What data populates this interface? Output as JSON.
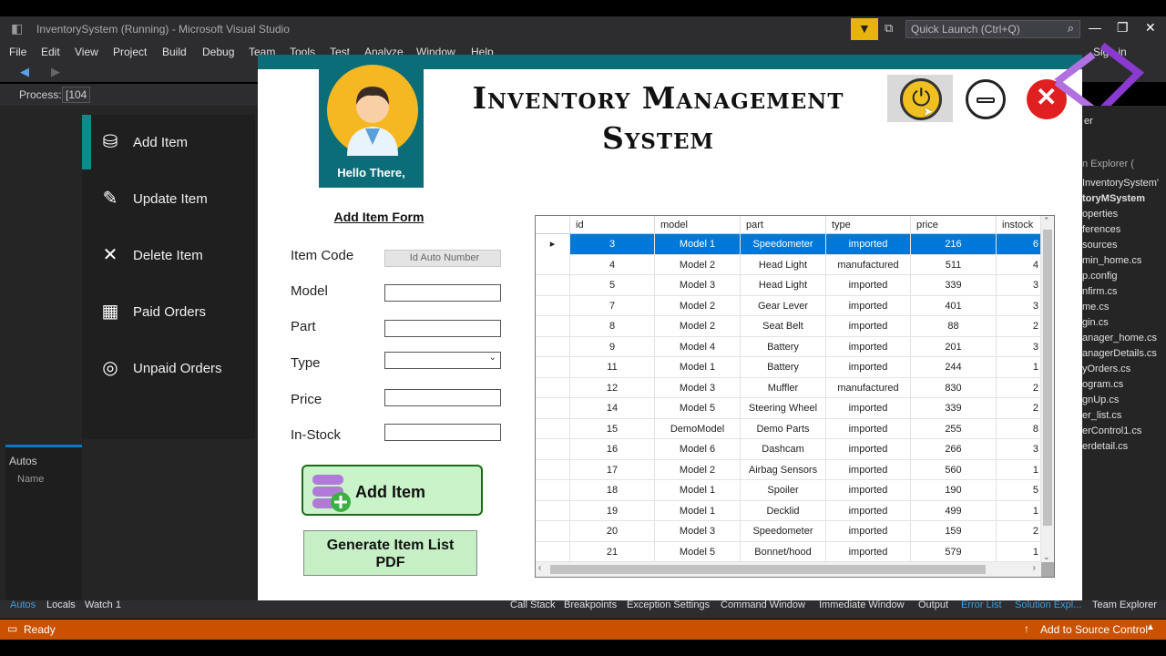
{
  "vs": {
    "title": "InventorySystem (Running) - Microsoft Visual Studio",
    "quick_launch": "Quick Launch (Ctrl+Q)",
    "sign_in": "Sign in",
    "menu": [
      "File",
      "Edit",
      "View",
      "Project",
      "Build",
      "Debug",
      "Team",
      "Tools",
      "Test",
      "Analyze",
      "Window",
      "Help"
    ],
    "process_label": "Process:",
    "process_value": "[104",
    "autos_title": "Autos",
    "autos_col": "Name",
    "bottom_left_tabs": [
      "Autos",
      "Locals",
      "Watch 1"
    ],
    "bottom_right_tabs": [
      "Call Stack",
      "Breakpoints",
      "Exception Settings",
      "Command Window",
      "Immediate Window",
      "Output",
      "Error List",
      "Solution Expl...",
      "Team Explorer"
    ],
    "status": "Ready",
    "source_control": "Add to Source Control",
    "explorer_header": "er",
    "explorer_search": "n Explorer (",
    "explorer_items": [
      "InventorySystem'",
      "toryMSystem",
      "operties",
      "ferences",
      "sources",
      "min_home.cs",
      "p.config",
      "nfirm.cs",
      "me.cs",
      "gin.cs",
      "anager_home.cs",
      "anagerDetails.cs",
      "yOrders.cs",
      "ogram.cs",
      "gnUp.cs",
      "er_list.cs",
      "erControl1.cs",
      "erdetail.cs"
    ]
  },
  "sidebar": {
    "items": [
      {
        "label": "Add Item",
        "icon": "database-add-icon"
      },
      {
        "label": "Update Item",
        "icon": "edit-list-icon"
      },
      {
        "label": "Delete Item",
        "icon": "close-icon"
      },
      {
        "label": "Paid Orders",
        "icon": "calendar-check-icon"
      },
      {
        "label": "Unpaid Orders",
        "icon": "clock-icon"
      }
    ]
  },
  "app": {
    "greeting": "Hello There,",
    "title_line1": "Inventory Management",
    "title_line2": "System"
  },
  "form": {
    "title": "Add Item Form",
    "labels": {
      "code": "Item Code",
      "model": "Model",
      "part": "Part",
      "type": "Type",
      "price": "Price",
      "stock": "In-Stock"
    },
    "code_value": "Id Auto Number",
    "add_button": "Add Item",
    "generate_line1": "Generate Item List",
    "generate_line2": "PDF"
  },
  "grid": {
    "columns": [
      "id",
      "model",
      "part",
      "type",
      "price",
      "instock"
    ],
    "rows": [
      [
        "3",
        "Model 1",
        "Speedometer",
        "imported",
        "216",
        "6"
      ],
      [
        "4",
        "Model 2",
        "Head Light",
        "manufactured",
        "511",
        "4"
      ],
      [
        "5",
        "Model 3",
        "Head Light",
        "imported",
        "339",
        "3"
      ],
      [
        "7",
        "Model 2",
        "Gear Lever",
        "imported",
        "401",
        "3"
      ],
      [
        "8",
        "Model 2",
        "Seat Belt",
        "imported",
        "88",
        "2"
      ],
      [
        "9",
        "Model 4",
        "Battery",
        "imported",
        "201",
        "3"
      ],
      [
        "11",
        "Model 1",
        "Battery",
        "imported",
        "244",
        "1"
      ],
      [
        "12",
        "Model 3",
        "Muffler",
        "manufactured",
        "830",
        "2"
      ],
      [
        "14",
        "Model 5",
        "Steering Wheel",
        "imported",
        "339",
        "2"
      ],
      [
        "15",
        "DemoModel",
        "Demo Parts",
        "imported",
        "255",
        "8"
      ],
      [
        "16",
        "Model 6",
        "Dashcam",
        "imported",
        "266",
        "3"
      ],
      [
        "17",
        "Model 2",
        "Airbag Sensors",
        "imported",
        "560",
        "1"
      ],
      [
        "18",
        "Model 1",
        "Spoiler",
        "imported",
        "190",
        "5"
      ],
      [
        "19",
        "Model 1",
        "Decklid",
        "imported",
        "499",
        "1"
      ],
      [
        "20",
        "Model 3",
        "Speedometer",
        "imported",
        "159",
        "2"
      ],
      [
        "21",
        "Model 5",
        "Bonnet/hood",
        "imported",
        "579",
        "1"
      ]
    ]
  },
  "colors": {
    "teal": "#0b6d77",
    "status_orange": "#ca5100",
    "selected_row": "#0078d7",
    "button_green": "#c9f3c9"
  }
}
